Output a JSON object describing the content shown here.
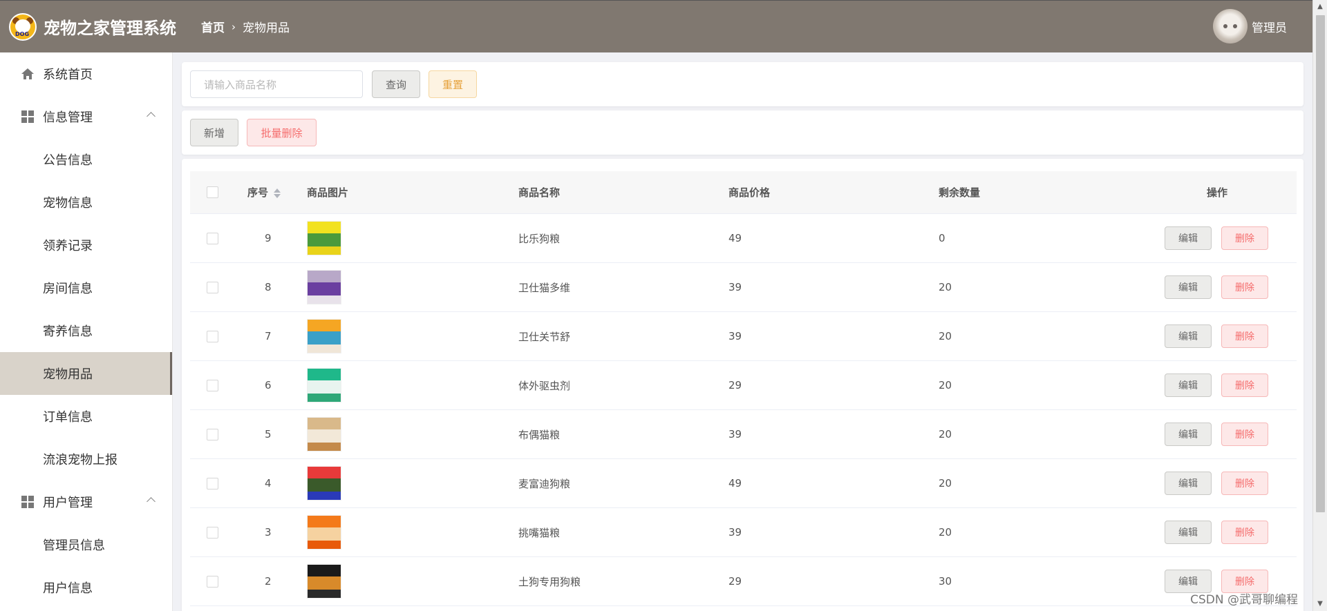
{
  "header": {
    "logo_text": "DOG",
    "app_title": "宠物之家管理系统",
    "breadcrumb_home": "首页",
    "breadcrumb_separator": "›",
    "breadcrumb_current": "宠物用品",
    "admin_name": "管理员"
  },
  "sidebar": {
    "items": [
      {
        "label": "系统首页",
        "type": "top",
        "icon": "home-icon"
      },
      {
        "label": "信息管理",
        "type": "group",
        "icon": "grid-icon",
        "expanded": true
      },
      {
        "label": "公告信息",
        "type": "sub"
      },
      {
        "label": "宠物信息",
        "type": "sub"
      },
      {
        "label": "领养记录",
        "type": "sub"
      },
      {
        "label": "房间信息",
        "type": "sub"
      },
      {
        "label": "寄养信息",
        "type": "sub"
      },
      {
        "label": "宠物用品",
        "type": "sub",
        "active": true
      },
      {
        "label": "订单信息",
        "type": "sub"
      },
      {
        "label": "流浪宠物上报",
        "type": "sub"
      },
      {
        "label": "用户管理",
        "type": "group",
        "icon": "grid-icon",
        "expanded": true
      },
      {
        "label": "管理员信息",
        "type": "sub"
      },
      {
        "label": "用户信息",
        "type": "sub"
      }
    ]
  },
  "search": {
    "placeholder": "请输入商品名称",
    "query_label": "查询",
    "reset_label": "重置"
  },
  "actions": {
    "add_label": "新增",
    "batch_delete_label": "批量删除"
  },
  "table": {
    "columns": {
      "id": "序号",
      "image": "商品图片",
      "name": "商品名称",
      "price": "商品价格",
      "stock": "剩余数量",
      "ops": "操作"
    },
    "edit_label": "编辑",
    "delete_label": "删除",
    "rows": [
      {
        "id": "9",
        "name": "比乐狗粮",
        "price": "49",
        "stock": "0",
        "colors": [
          "#f2e21f",
          "#4a9a3c",
          "#e9d31a"
        ]
      },
      {
        "id": "8",
        "name": "卫仕猫多维",
        "price": "39",
        "stock": "20",
        "colors": [
          "#b8a8c8",
          "#6a3fa0",
          "#e8e2ea"
        ]
      },
      {
        "id": "7",
        "name": "卫仕关节舒",
        "price": "39",
        "stock": "20",
        "colors": [
          "#f5a623",
          "#3aa0c8",
          "#f0e6d8"
        ]
      },
      {
        "id": "6",
        "name": "体外驱虫剂",
        "price": "29",
        "stock": "20",
        "colors": [
          "#1fb88a",
          "#e8f4ef",
          "#2ea878"
        ]
      },
      {
        "id": "5",
        "name": "布偶猫粮",
        "price": "39",
        "stock": "20",
        "colors": [
          "#d9b98a",
          "#f2e8d8",
          "#c48a4a"
        ]
      },
      {
        "id": "4",
        "name": "麦富迪狗粮",
        "price": "49",
        "stock": "20",
        "colors": [
          "#e83a3a",
          "#3a5a2a",
          "#2a3ab8"
        ]
      },
      {
        "id": "3",
        "name": "挑嘴猫粮",
        "price": "39",
        "stock": "20",
        "colors": [
          "#f47a1a",
          "#f6d2a0",
          "#e85a0a"
        ]
      },
      {
        "id": "2",
        "name": "土狗专用狗粮",
        "price": "29",
        "stock": "30",
        "colors": [
          "#1a1a1a",
          "#d88a2a",
          "#2a2a2a"
        ]
      }
    ]
  },
  "watermark": "CSDN @武哥聊编程"
}
